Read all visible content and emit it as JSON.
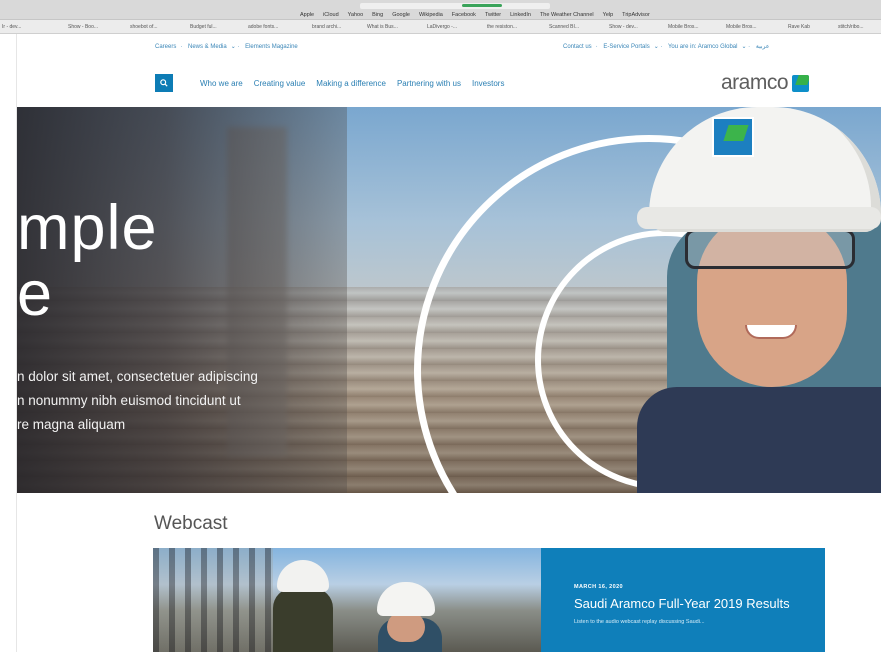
{
  "browser": {
    "favorites": [
      "Apple",
      "iCloud",
      "Yahoo",
      "Bing",
      "Google",
      "Wikipedia",
      "Facebook",
      "Twitter",
      "LinkedIn",
      "The Weather Channel",
      "Yelp",
      "TripAdvisor"
    ],
    "bookmarks": [
      "Ir - dev...",
      "Show - Boo...",
      "shoebot of...",
      "Budget ful...",
      "adobe fonts...",
      "brand archi...",
      "What is Bus...",
      "LaDivergo -...",
      "the resiston...",
      "Scanned BI...",
      "Show - dev...",
      "Mobile Bros...",
      "Mobile Bros...",
      "Rave Kab",
      "stitch/ribo..."
    ]
  },
  "utility_nav": {
    "left": [
      "Careers",
      "News & Media",
      "Elements Magazine"
    ],
    "right": [
      "Contact us",
      "E-Service Portals",
      "You are in: Aramco Global",
      "عربية"
    ]
  },
  "main_nav": {
    "items": [
      "Who we are",
      "Creating value",
      "Making a difference",
      "Partnering with us",
      "Investors"
    ]
  },
  "logo": {
    "text": "aramco"
  },
  "hero": {
    "title_line1": "mple",
    "title_line2": "e",
    "body_line1": "n dolor sit amet, consectetuer adipiscing",
    "body_line2": "n nonummy nibh euismod tincidunt ut",
    "body_line3": "re magna aliquam"
  },
  "webcast": {
    "section_title": "Webcast",
    "date": "MARCH 16, 2020",
    "headline": "Saudi Aramco Full-Year 2019 Results",
    "description": "Listen to the audio webcast replay discussing Saudi..."
  },
  "colors": {
    "brand_blue": "#0d7cb5",
    "brand_green": "#36b14a",
    "panel_blue": "#0f7fba"
  }
}
